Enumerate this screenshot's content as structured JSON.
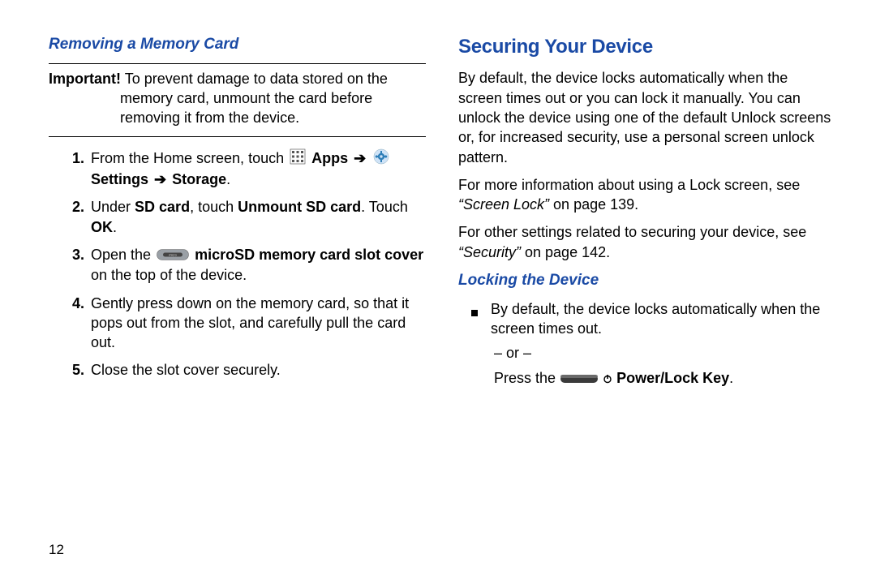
{
  "page_number": "12",
  "left": {
    "heading": "Removing a Memory Card",
    "important": {
      "label": "Important!",
      "text": "To prevent damage to data stored on the memory card, unmount the card before removing it from the device."
    },
    "steps": {
      "s1": {
        "num": "1.",
        "pre_text": "From the Home screen, touch ",
        "apps_label": "Apps",
        "arrow": " ➔ ",
        "settings_label": "Settings",
        "storage_label": "Storage",
        "period": "."
      },
      "s2": {
        "num": "2.",
        "t1": "Under ",
        "b1": "SD card",
        "t2": ", touch ",
        "b2": "Unmount SD card",
        "t3": ". Touch ",
        "b3": "OK",
        "t4": "."
      },
      "s3": {
        "num": "3.",
        "t1": "Open the ",
        "b1": "microSD memory card slot cover",
        "t2": " on the top of the device."
      },
      "s4": {
        "num": "4.",
        "text": "Gently press down on the memory card, so that it pops out from the slot, and carefully pull the card out."
      },
      "s5": {
        "num": "5.",
        "text": "Close the slot cover securely."
      }
    }
  },
  "right": {
    "heading": "Securing Your Device",
    "p1": "By default, the device locks automatically when the screen times out or you can lock it manually. You can unlock the device using one of the default Unlock screens or, for increased security, use a personal screen unlock pattern.",
    "p2": {
      "t1": "For more information about using a Lock screen, see ",
      "ref": "“Screen Lock”",
      "t2": " on page 139."
    },
    "p3": {
      "t1": "For other settings related to securing your device, see ",
      "ref": "“Security”",
      "t2": " on page 142."
    },
    "subheading": "Locking the Device",
    "bullet": "By default, the device locks automatically when the screen times out.",
    "or_text": "– or –",
    "press": {
      "t1": "Press the ",
      "b1": "Power/Lock Key",
      "t2": "."
    }
  }
}
